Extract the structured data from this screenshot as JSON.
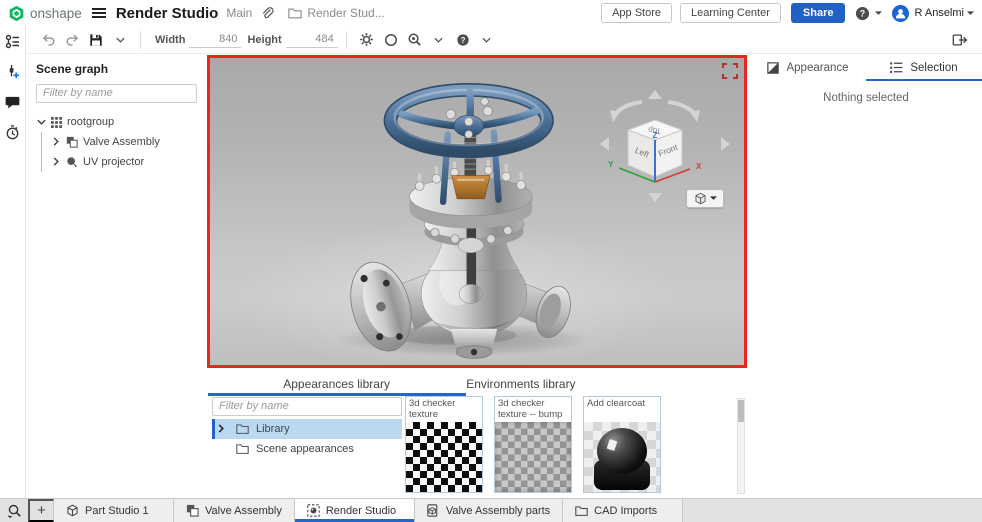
{
  "header": {
    "brand": "onshape",
    "title": "Render Studio",
    "workspace": "Main",
    "document_tab": "Render Stud...",
    "buttons": {
      "app_store": "App Store",
      "learning_center": "Learning Center",
      "share": "Share"
    },
    "user": "R Anselmi"
  },
  "toolbar": {
    "width_label": "Width",
    "width_value": "840",
    "height_label": "Height",
    "height_value": "484"
  },
  "scene_graph": {
    "title": "Scene graph",
    "filter_placeholder": "Filter by name",
    "nodes": [
      {
        "label": "rootgroup"
      },
      {
        "label": "Valve Assembly"
      },
      {
        "label": "UV projector"
      }
    ]
  },
  "viewport": {
    "viewcube": {
      "top": "Top",
      "left": "Left",
      "front": "Front",
      "x": "X",
      "y": "Y",
      "z": "Z"
    }
  },
  "right_panel": {
    "tabs": [
      {
        "label": "Appearance"
      },
      {
        "label": "Selection"
      }
    ],
    "message": "Nothing selected"
  },
  "library": {
    "tabs": [
      {
        "label": "Appearances library"
      },
      {
        "label": "Environments library"
      }
    ],
    "filter_placeholder": "Filter by name",
    "folders": [
      {
        "label": "Library"
      },
      {
        "label": "Scene appearances"
      }
    ],
    "cards": [
      {
        "title": "3d checker texture"
      },
      {
        "title": "3d checker texture -- bump"
      },
      {
        "title": "Add clearcoat"
      }
    ]
  },
  "tab_bar": {
    "add": "+",
    "tabs": [
      {
        "label": "Part Studio 1"
      },
      {
        "label": "Valve Assembly"
      },
      {
        "label": "Render Studio"
      },
      {
        "label": "Valve Assembly parts"
      },
      {
        "label": "CAD Imports"
      }
    ]
  },
  "colors": {
    "accent_blue": "#2566c8",
    "share_blue": "#2160c4",
    "viewport_border_red": "#e8261e",
    "logo_green": "#10b464",
    "tree_selection": "#b9d9f3"
  }
}
